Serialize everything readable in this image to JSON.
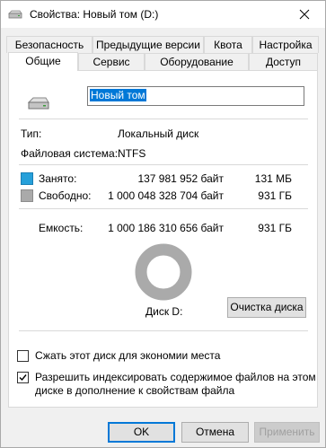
{
  "window": {
    "title": "Свойства: Новый том (D:)"
  },
  "tabs_row1": [
    "Безопасность",
    "Предыдущие версии",
    "Квота",
    "Настройка"
  ],
  "tabs_row2": [
    "Общие",
    "Сервис",
    "Оборудование",
    "Доступ"
  ],
  "general": {
    "volume_name": "Новый том",
    "type_label": "Тип:",
    "type_value": "Локальный диск",
    "fs_label": "Файловая система:",
    "fs_value": "NTFS",
    "used_label": "Занято:",
    "used_bytes": "137 981 952 байт",
    "used_size": "131 МБ",
    "free_label": "Свободно:",
    "free_bytes": "1 000 048 328 704 байт",
    "free_size": "931 ГБ",
    "capacity_label": "Емкость:",
    "capacity_bytes": "1 000 186 310 656 байт",
    "capacity_size": "931 ГБ",
    "disk_label": "Диск D:",
    "cleanup_button": "Очистка диска",
    "compress_label": "Сжать этот диск для экономии места",
    "compress_checked": false,
    "index_label_line1": "Разрешить индексировать содержимое файлов на этом",
    "index_label_line2": "диске в дополнение к свойствам файла",
    "index_checked": true,
    "used_fraction": 0.000138,
    "colors": {
      "used": "#26a0da",
      "free": "#aaaaaa"
    }
  },
  "buttons": {
    "ok": "OK",
    "cancel": "Отмена",
    "apply": "Применить"
  }
}
